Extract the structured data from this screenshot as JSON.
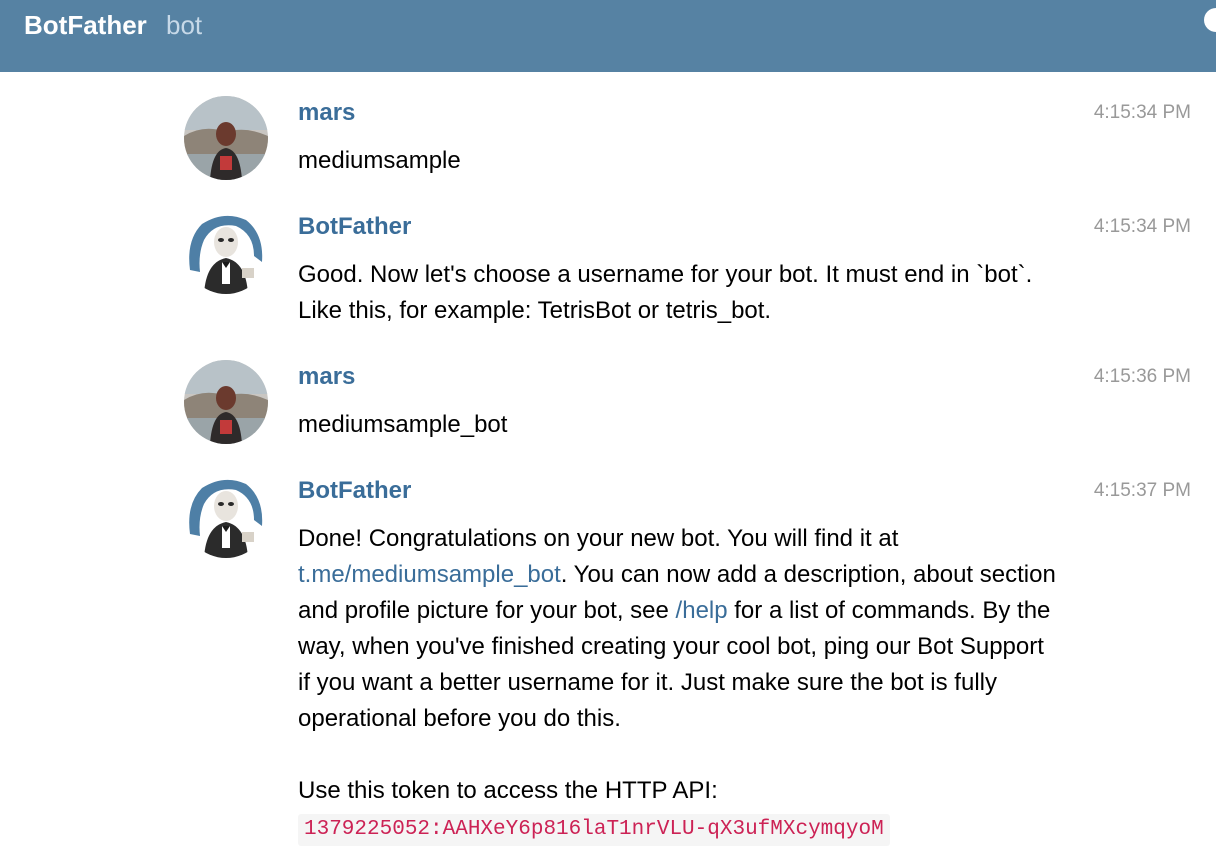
{
  "header": {
    "title": "BotFather",
    "subtitle": "bot"
  },
  "messages": [
    {
      "author": "mars",
      "time": "4:15:34 PM",
      "avatar_icon": "user-avatar",
      "text": "mediumsample"
    },
    {
      "author": "BotFather",
      "time": "4:15:34 PM",
      "avatar_icon": "botfather-avatar",
      "text": "Good. Now let's choose a username for your bot. It must end in `bot`. Like this, for example: TetrisBot or tetris_bot."
    },
    {
      "author": "mars",
      "time": "4:15:36 PM",
      "avatar_icon": "user-avatar",
      "text": "mediumsample_bot"
    },
    {
      "author": "BotFather",
      "time": "4:15:37 PM",
      "avatar_icon": "botfather-avatar",
      "text_before_link": "Done! Congratulations on your new bot. You will find it at ",
      "link": "t.me/mediumsample_bot",
      "text_after_link": ". You can now add a description, about section and profile picture for your bot, see ",
      "help_link": "/help",
      "text_after_help": " for a list of commands. By the way, when you've finished creating your cool bot, ping our Bot Support if you want a better username for it. Just make sure the bot is fully operational before you do this.",
      "token_intro": "Use this token to access the HTTP API:",
      "token": "1379225052:AAHXeY6p816laT1nrVLU-qX3ufMXcymqyoM"
    }
  ],
  "colors": {
    "header_bg": "#5682a3",
    "author": "#3a6d99",
    "link": "#3a6d99",
    "token": "#cc2255"
  }
}
